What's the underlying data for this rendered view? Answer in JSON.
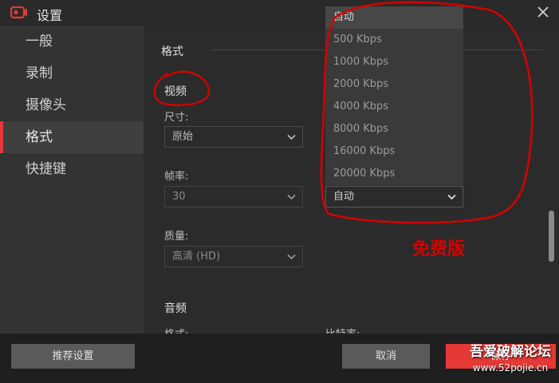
{
  "window": {
    "title": "设置"
  },
  "sidebar": {
    "items": [
      {
        "label": "一般"
      },
      {
        "label": "录制"
      },
      {
        "label": "摄像头"
      },
      {
        "label": "格式"
      },
      {
        "label": "快捷键"
      }
    ],
    "active_index": 3
  },
  "format": {
    "section_title": "格式",
    "video": {
      "title": "视频",
      "size_label": "尺寸:",
      "size_value": "原始",
      "framerate_label": "帧率:",
      "framerate_value": "30",
      "quality_label": "质量:",
      "quality_value": "高清 (HD)",
      "bitrate_value": "自动"
    },
    "audio": {
      "title": "音频",
      "format_label": "格式:",
      "bitrate_label": "比特率:"
    }
  },
  "bitrate_dropdown": {
    "options": [
      "自动",
      "500 Kbps",
      "1000 Kbps",
      "2000 Kbps",
      "4000 Kbps",
      "8000 Kbps",
      "16000 Kbps",
      "20000 Kbps"
    ],
    "selected_index": 0
  },
  "footer": {
    "recommend_label": "推荐设置",
    "cancel_label": "取消",
    "save_label": "保存"
  },
  "annotation": {
    "text": "免费版"
  },
  "watermark": {
    "site_name": "吾爱破解论坛",
    "url": "www.52pojie.cn"
  },
  "colors": {
    "accent": "#e53935",
    "annotation": "#d40000",
    "background": "#2b2b2b",
    "sidebar": "#333333"
  },
  "icons": {
    "app": "record-camera-icon",
    "close": "close-icon",
    "dropdown": "chevron-down-icon"
  }
}
